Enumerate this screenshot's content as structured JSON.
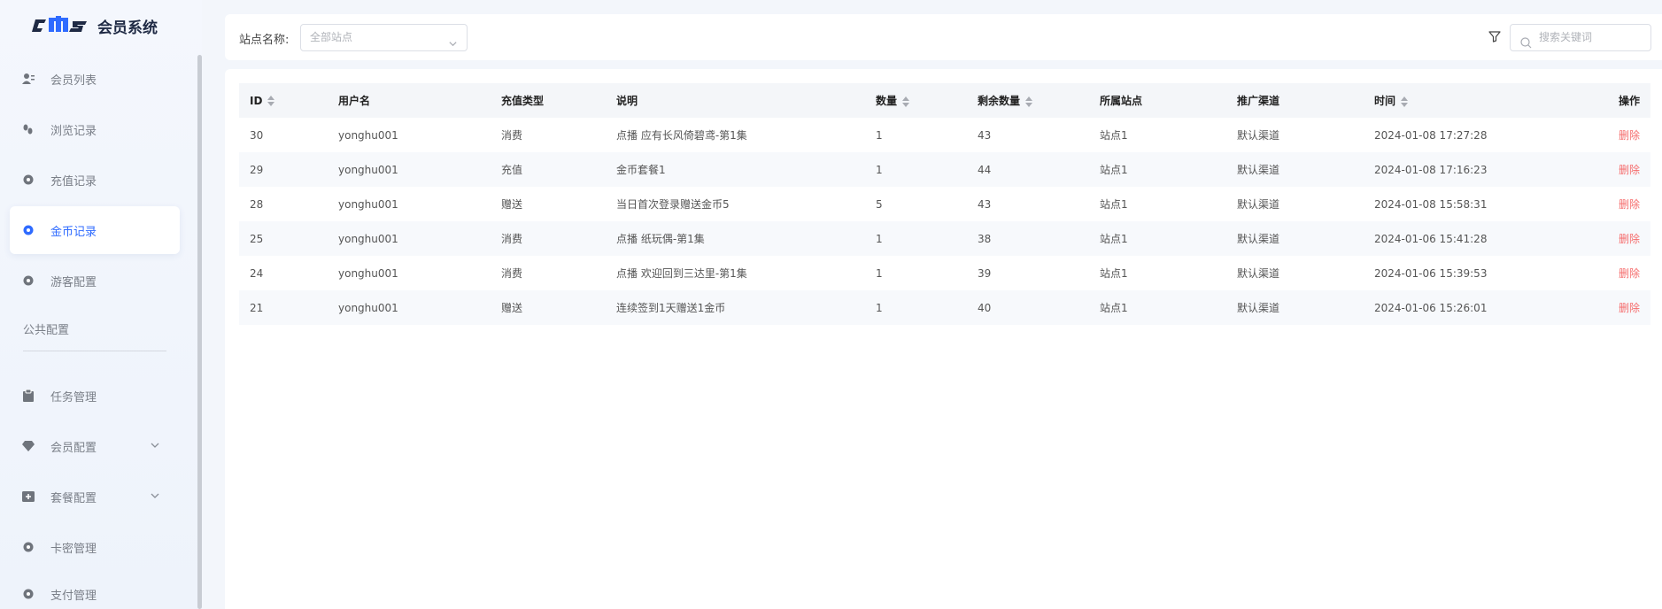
{
  "app": {
    "logo_mark": "cms",
    "title": "会员系统"
  },
  "sidebar": {
    "items": [
      {
        "label": "会员列表",
        "icon": "user-list-icon"
      },
      {
        "label": "浏览记录",
        "icon": "footprint-icon"
      },
      {
        "label": "充值记录",
        "icon": "circle-dot-icon"
      },
      {
        "label": "金币记录",
        "icon": "circle-dot-icon",
        "active": true
      },
      {
        "label": "游客配置",
        "icon": "circle-dot-icon"
      }
    ],
    "section_label": "公共配置",
    "section_items": [
      {
        "label": "任务管理",
        "icon": "clipboard-icon"
      },
      {
        "label": "会员配置",
        "icon": "diamond-icon",
        "expandable": true
      },
      {
        "label": "套餐配置",
        "icon": "package-icon",
        "expandable": true
      },
      {
        "label": "卡密管理",
        "icon": "circle-dot-icon"
      },
      {
        "label": "支付管理",
        "icon": "circle-dot-icon"
      }
    ]
  },
  "filters": {
    "site_label": "站点名称:",
    "site_placeholder": "全部站点",
    "search_placeholder": "搜索关键词"
  },
  "table": {
    "columns": [
      {
        "label": "ID",
        "sortable": true
      },
      {
        "label": "用户名",
        "sortable": false
      },
      {
        "label": "充值类型",
        "sortable": false
      },
      {
        "label": "说明",
        "sortable": false
      },
      {
        "label": "数量",
        "sortable": true
      },
      {
        "label": "剩余数量",
        "sortable": true
      },
      {
        "label": "所属站点",
        "sortable": false
      },
      {
        "label": "推广渠道",
        "sortable": false
      },
      {
        "label": "时间",
        "sortable": true
      },
      {
        "label": "操作",
        "sortable": false
      }
    ],
    "delete_label": "删除",
    "rows": [
      {
        "id": "30",
        "username": "yonghu001",
        "type": "消费",
        "desc": "点播 应有长风倚碧鸢-第1集",
        "qty": "1",
        "remain": "43",
        "site": "站点1",
        "channel": "默认渠道",
        "time": "2024-01-08 17:27:28"
      },
      {
        "id": "29",
        "username": "yonghu001",
        "type": "充值",
        "desc": "金币套餐1",
        "qty": "1",
        "remain": "44",
        "site": "站点1",
        "channel": "默认渠道",
        "time": "2024-01-08 17:16:23"
      },
      {
        "id": "28",
        "username": "yonghu001",
        "type": "赠送",
        "desc": "当日首次登录赠送金币5",
        "qty": "5",
        "remain": "43",
        "site": "站点1",
        "channel": "默认渠道",
        "time": "2024-01-08 15:58:31"
      },
      {
        "id": "25",
        "username": "yonghu001",
        "type": "消费",
        "desc": "点播 纸玩偶-第1集",
        "qty": "1",
        "remain": "38",
        "site": "站点1",
        "channel": "默认渠道",
        "time": "2024-01-06 15:41:28"
      },
      {
        "id": "24",
        "username": "yonghu001",
        "type": "消费",
        "desc": "点播 欢迎回到三达里-第1集",
        "qty": "1",
        "remain": "39",
        "site": "站点1",
        "channel": "默认渠道",
        "time": "2024-01-06 15:39:53"
      },
      {
        "id": "21",
        "username": "yonghu001",
        "type": "赠送",
        "desc": "连续签到1天赠送1金币",
        "qty": "1",
        "remain": "40",
        "site": "站点1",
        "channel": "默认渠道",
        "time": "2024-01-06 15:26:01"
      }
    ]
  },
  "colors": {
    "accent": "#2f6bff",
    "danger": "#f56c6c"
  }
}
